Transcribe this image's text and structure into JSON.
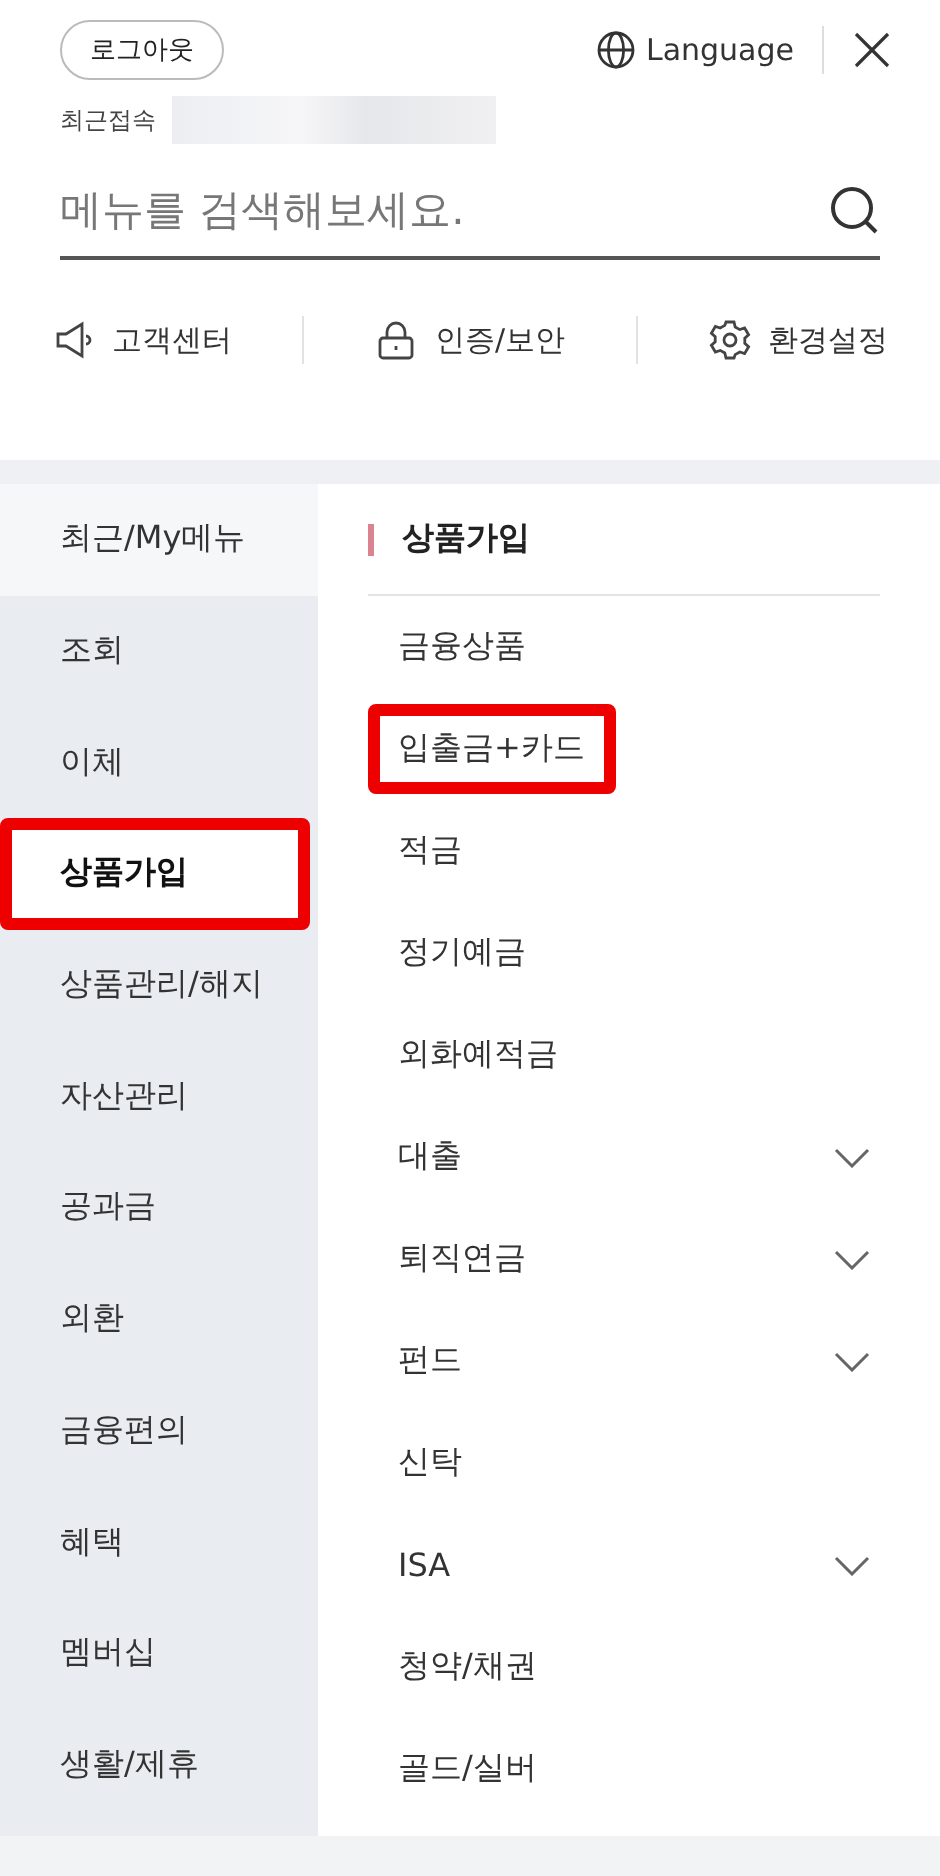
{
  "header": {
    "logout_button": "로그아웃",
    "language_button": "Language",
    "last_access_label": "최근접속"
  },
  "search": {
    "placeholder": "메뉴를 검색해보세요."
  },
  "quick_links": [
    {
      "kind": "support",
      "label": "고객센터"
    },
    {
      "kind": "security",
      "label": "인증/보안"
    },
    {
      "kind": "settings",
      "label": "환경설정"
    }
  ],
  "categories": [
    {
      "label": "최근/My메뉴",
      "kind": "recent",
      "selected": false,
      "highlighted": false
    },
    {
      "label": "조회",
      "kind": "category",
      "selected": false,
      "highlighted": false
    },
    {
      "label": "이체",
      "kind": "category",
      "selected": false,
      "highlighted": false
    },
    {
      "label": "상품가입",
      "kind": "category",
      "selected": true,
      "highlighted": true
    },
    {
      "label": "상품관리/해지",
      "kind": "category",
      "selected": false,
      "highlighted": false
    },
    {
      "label": "자산관리",
      "kind": "category",
      "selected": false,
      "highlighted": false
    },
    {
      "label": "공과금",
      "kind": "category",
      "selected": false,
      "highlighted": false
    },
    {
      "label": "외환",
      "kind": "category",
      "selected": false,
      "highlighted": false
    },
    {
      "label": "금융편의",
      "kind": "category",
      "selected": false,
      "highlighted": false
    },
    {
      "label": "혜택",
      "kind": "category",
      "selected": false,
      "highlighted": false
    },
    {
      "label": "멤버십",
      "kind": "category",
      "selected": false,
      "highlighted": false
    },
    {
      "label": "생활/제휴",
      "kind": "category",
      "selected": false,
      "highlighted": false
    }
  ],
  "submenu": {
    "title": "상품가입",
    "items": [
      {
        "label": "금융상품",
        "expandable": false,
        "highlighted": false
      },
      {
        "label": "입출금+카드",
        "expandable": false,
        "highlighted": true
      },
      {
        "label": "적금",
        "expandable": false,
        "highlighted": false
      },
      {
        "label": "정기예금",
        "expandable": false,
        "highlighted": false
      },
      {
        "label": "외화예적금",
        "expandable": false,
        "highlighted": false
      },
      {
        "label": "대출",
        "expandable": true,
        "highlighted": false
      },
      {
        "label": "퇴직연금",
        "expandable": true,
        "highlighted": false
      },
      {
        "label": "펀드",
        "expandable": true,
        "highlighted": false
      },
      {
        "label": "신탁",
        "expandable": false,
        "highlighted": false
      },
      {
        "label": "ISA",
        "expandable": true,
        "highlighted": false
      },
      {
        "label": "청약/채권",
        "expandable": false,
        "highlighted": false
      },
      {
        "label": "골드/실버",
        "expandable": false,
        "highlighted": false
      }
    ]
  }
}
